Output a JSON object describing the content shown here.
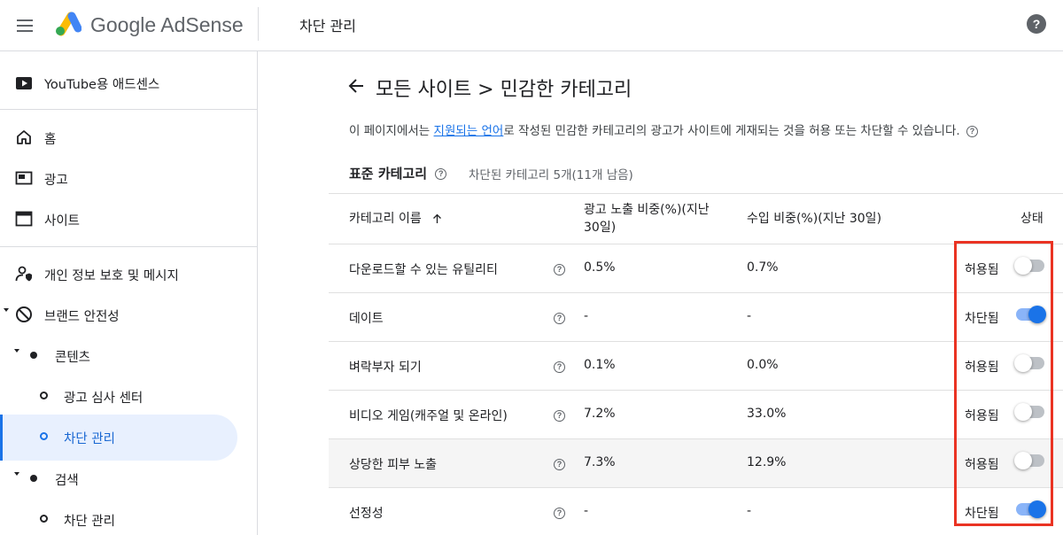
{
  "app": {
    "brand": "Google AdSense",
    "page_title": "차단 관리"
  },
  "sidebar": {
    "items": [
      {
        "label": "YouTube용 애드센스",
        "icon": "youtube-icon"
      },
      {
        "label": "홈",
        "icon": "home-icon"
      },
      {
        "label": "광고",
        "icon": "ads-icon"
      },
      {
        "label": "사이트",
        "icon": "sites-icon"
      },
      {
        "label": "개인 정보 보호 및 메시지",
        "icon": "privacy-icon"
      },
      {
        "label": "브랜드 안전성",
        "icon": "block-icon"
      },
      {
        "label": "콘텐츠"
      },
      {
        "label": "광고 심사 센터"
      },
      {
        "label": "차단 관리",
        "active": true
      },
      {
        "label": "검색"
      },
      {
        "label": "차단 관리"
      }
    ]
  },
  "main": {
    "breadcrumb": "모든 사이트 > 민감한 카테고리",
    "desc_prefix": "이 페이지에서는 ",
    "desc_link": "지원되는 언어",
    "desc_suffix": "로 작성된 민감한 카테고리의 광고가 사이트에 게재되는 것을 허용 또는 차단할 수 있습니다.",
    "section_title": "표준 카테고리",
    "section_sub": "차단된 카테고리 5개(11개 남음)",
    "columns": {
      "name": "카테고리 이름",
      "impressions_line1": "광고 노출 비중(%)(지난",
      "impressions_line2": "30일)",
      "revenue": "수입 비중(%)(지난 30일)",
      "status": "상태"
    },
    "rows": [
      {
        "name": "다운로드할 수 있는 유틸리티",
        "impressions": "0.5%",
        "revenue": "0.7%",
        "status": "허용됨",
        "blocked": false
      },
      {
        "name": "데이트",
        "impressions": "-",
        "revenue": "-",
        "status": "차단됨",
        "blocked": true
      },
      {
        "name": "벼락부자 되기",
        "impressions": "0.1%",
        "revenue": "0.0%",
        "status": "허용됨",
        "blocked": false
      },
      {
        "name": "비디오 게임(캐주얼 및 온라인)",
        "impressions": "7.2%",
        "revenue": "33.0%",
        "status": "허용됨",
        "blocked": false
      },
      {
        "name": "상당한 피부 노출",
        "impressions": "7.3%",
        "revenue": "12.9%",
        "status": "허용됨",
        "blocked": false,
        "hovered": true
      },
      {
        "name": "선정성",
        "impressions": "-",
        "revenue": "-",
        "status": "차단됨",
        "blocked": true
      }
    ]
  },
  "colors": {
    "accent": "#1a73e8",
    "highlight": "#ea3323",
    "active_bg": "#e8f0fe"
  }
}
